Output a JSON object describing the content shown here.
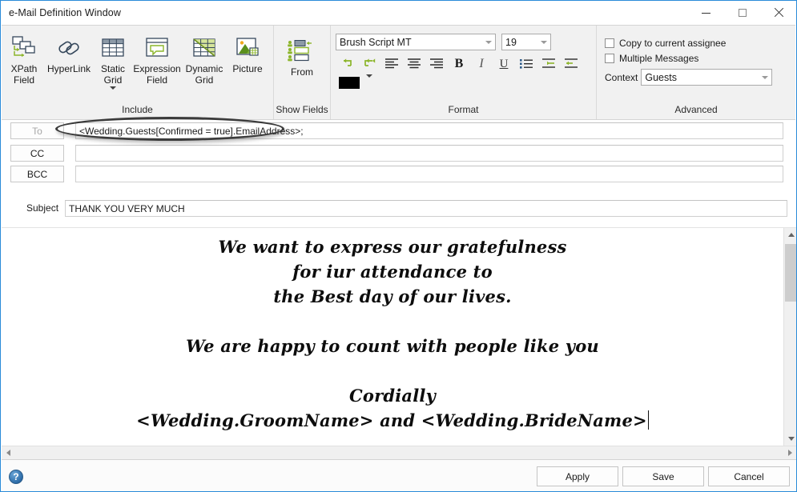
{
  "window": {
    "title": "e-Mail Definition Window",
    "controls": {
      "minimize": "minimize-icon",
      "maximize": "maximize-icon",
      "close": "close-icon"
    }
  },
  "ribbon": {
    "groups": [
      {
        "label": "Include",
        "buttons": [
          {
            "label": "XPath\nField",
            "icon": "xpath-field-icon",
            "has_dropdown": false
          },
          {
            "label": "HyperLink",
            "icon": "hyperlink-icon",
            "has_dropdown": false
          },
          {
            "label": "Static\nGrid",
            "icon": "static-grid-icon",
            "has_dropdown": true
          },
          {
            "label": "Expression\nField",
            "icon": "expression-field-icon",
            "has_dropdown": false
          },
          {
            "label": "Dynamic\nGrid",
            "icon": "dynamic-grid-icon",
            "has_dropdown": false
          },
          {
            "label": "Picture",
            "icon": "picture-icon",
            "has_dropdown": false
          }
        ]
      },
      {
        "label": "Show Fields",
        "buttons": [
          {
            "label": "From",
            "icon": "from-field-icon",
            "has_dropdown": false
          }
        ]
      },
      {
        "label": "Format"
      },
      {
        "label": "Advanced"
      }
    ]
  },
  "format": {
    "font_family": "Brush Script MT",
    "font_size": "19",
    "tools": [
      {
        "name": "undo-icon",
        "title": "Undo"
      },
      {
        "name": "redo-icon",
        "title": "Redo"
      },
      {
        "name": "align-left-icon",
        "title": "Align Left"
      },
      {
        "name": "align-center-icon",
        "title": "Align Center"
      },
      {
        "name": "align-right-icon",
        "title": "Align Right"
      },
      {
        "name": "bold-icon",
        "title": "B"
      },
      {
        "name": "italic-icon",
        "title": "I"
      },
      {
        "name": "underline-icon",
        "title": "U"
      },
      {
        "name": "bullet-list-icon",
        "title": "Bullets"
      },
      {
        "name": "increase-indent-icon",
        "title": "Increase Indent"
      },
      {
        "name": "decrease-indent-icon",
        "title": "Decrease Indent"
      }
    ],
    "font_color": "#000000"
  },
  "advanced": {
    "copy_to_assignee_label": "Copy to current assignee",
    "copy_to_assignee_checked": false,
    "multiple_messages_label": "Multiple Messages",
    "multiple_messages_checked": false,
    "context_label": "Context",
    "context_value": "Guests"
  },
  "address": {
    "to_label": "To",
    "to_value": "<Wedding.Guests[Confirmed = true].EmailAddress>;",
    "cc_label": "CC",
    "cc_value": "",
    "bcc_label": "BCC",
    "bcc_value": "",
    "subject_label": "Subject",
    "subject_value": "THANK YOU VERY MUCH"
  },
  "body": {
    "lines": [
      "We want to express our gratefulness",
      "for iur attendance to",
      "the Best day of our lives.",
      "",
      "We are happy to count with people like you",
      "",
      "Cordially",
      "<Wedding.GroomName> and <Wedding.BrideName>"
    ]
  },
  "footer": {
    "help": "?",
    "apply_label": "Apply",
    "save_label": "Save",
    "cancel_label": "Cancel"
  },
  "colors": {
    "window_border": "#2a8bd9",
    "ribbon_background": "#f1f1f1",
    "accent_green": "#8cb52a",
    "icon_navy": "#36485c"
  }
}
